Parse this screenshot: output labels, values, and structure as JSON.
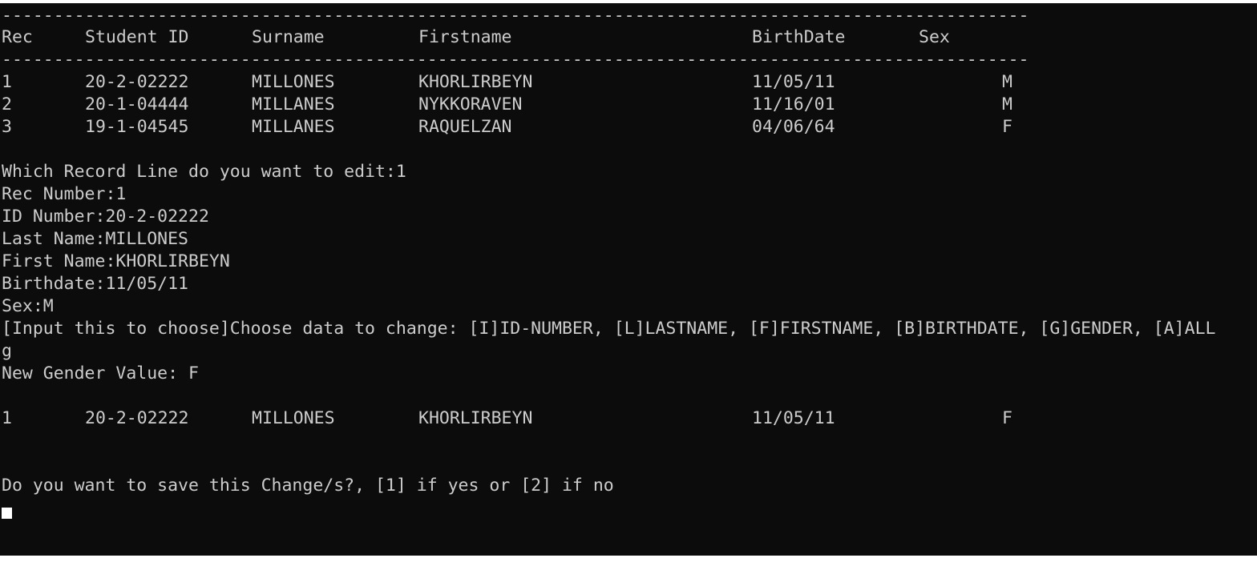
{
  "separator": "---------------------------------------------------------------------------------------------------",
  "table": {
    "headers": {
      "rec": "Rec",
      "student_id": "Student ID",
      "surname": "Surname",
      "firstname": "Firstname",
      "birthdate": "BirthDate",
      "sex": "Sex"
    },
    "rows": [
      {
        "rec": "1",
        "student_id": "20-2-02222",
        "surname": "MILLONES",
        "firstname": "KHORLIRBEYN",
        "birthdate": "11/05/11",
        "sex": "M"
      },
      {
        "rec": "2",
        "student_id": "20-1-04444",
        "surname": "MILLANES",
        "firstname": "NYKKORAVEN",
        "birthdate": "11/16/01",
        "sex": "M"
      },
      {
        "rec": "3",
        "student_id": "19-1-04545",
        "surname": "MILLANES",
        "firstname": "RAQUELZAN",
        "birthdate": "04/06/64",
        "sex": "F"
      }
    ]
  },
  "dialog": {
    "which_record": "Which Record Line do you want to edit:1",
    "rec_number": "Rec Number:1",
    "id_number": "ID Number:20-2-02222",
    "last_name": "Last Name:MILLONES",
    "first_name": "First Name:KHORLIRBEYN",
    "birthdate": "Birthdate:11/05/11",
    "sex": "Sex:M",
    "choose_prompt": "[Input this to choose]Choose data to change: [I]ID-NUMBER, [L]LASTNAME, [F]FIRSTNAME, [B]BIRTHDATE, [G]GENDER, [A]ALL",
    "choice_input": "g",
    "new_gender": "New Gender Value: F"
  },
  "updated_row": {
    "rec": "1",
    "student_id": "20-2-02222",
    "surname": "MILLONES",
    "firstname": "KHORLIRBEYN",
    "birthdate": "11/05/11",
    "sex": "F"
  },
  "save_prompt": "Do you want to save this Change/s?, [1] if yes or [2] if no",
  "colors": {
    "background": "#0c0c0c",
    "text": "#cccccc",
    "cursor": "#ffffff"
  }
}
